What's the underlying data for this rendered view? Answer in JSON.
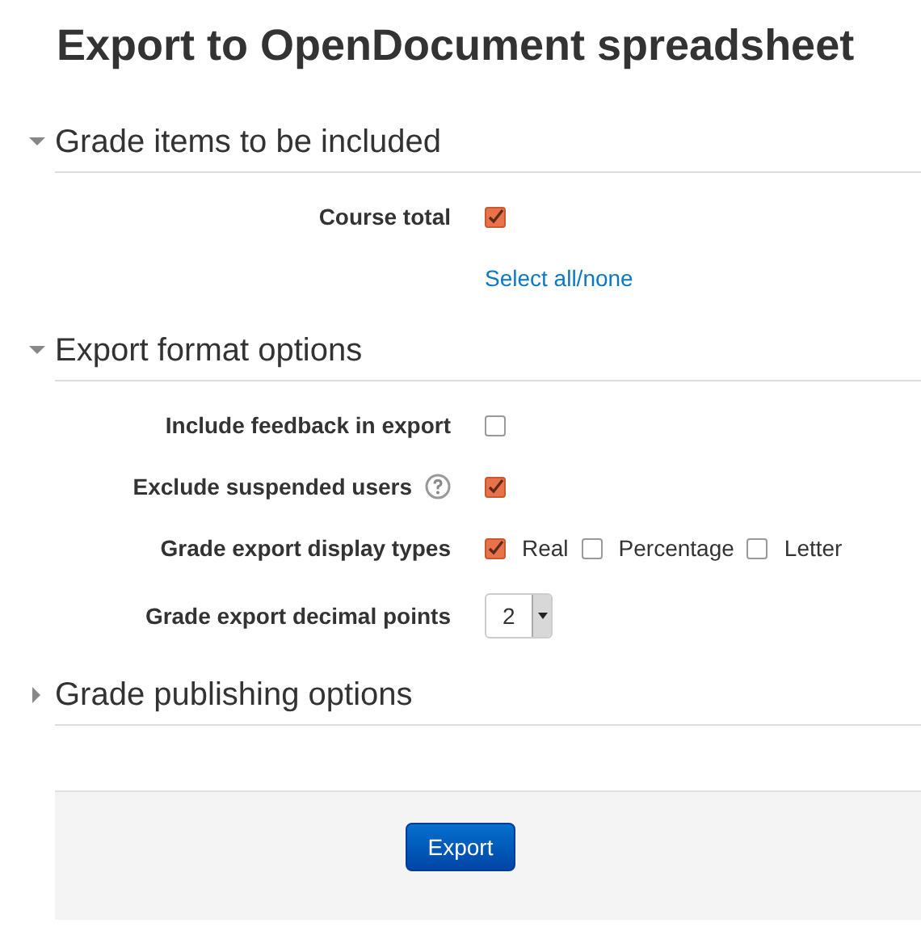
{
  "title": "Export to OpenDocument spreadsheet",
  "sections": [
    {
      "heading": "Grade items to be included",
      "expanded": true,
      "rows": [
        {
          "kind": "checkbox",
          "label": "Course total",
          "checked": true
        },
        {
          "kind": "link",
          "link": "Select all/none"
        }
      ]
    },
    {
      "heading": "Export format options",
      "expanded": true,
      "rows": [
        {
          "kind": "checkbox",
          "label": "Include feedback in export",
          "checked": false
        },
        {
          "kind": "checkbox",
          "label": "Exclude suspended users",
          "help": true,
          "checked": true
        },
        {
          "kind": "options",
          "label": "Grade export display types",
          "options": [
            {
              "label": "Real",
              "checked": true
            },
            {
              "label": "Percentage",
              "checked": false
            },
            {
              "label": "Letter",
              "checked": false
            }
          ]
        },
        {
          "kind": "select",
          "label": "Grade export decimal points",
          "value": "2"
        }
      ]
    },
    {
      "heading": "Grade publishing options",
      "expanded": false
    }
  ],
  "button": "Export"
}
